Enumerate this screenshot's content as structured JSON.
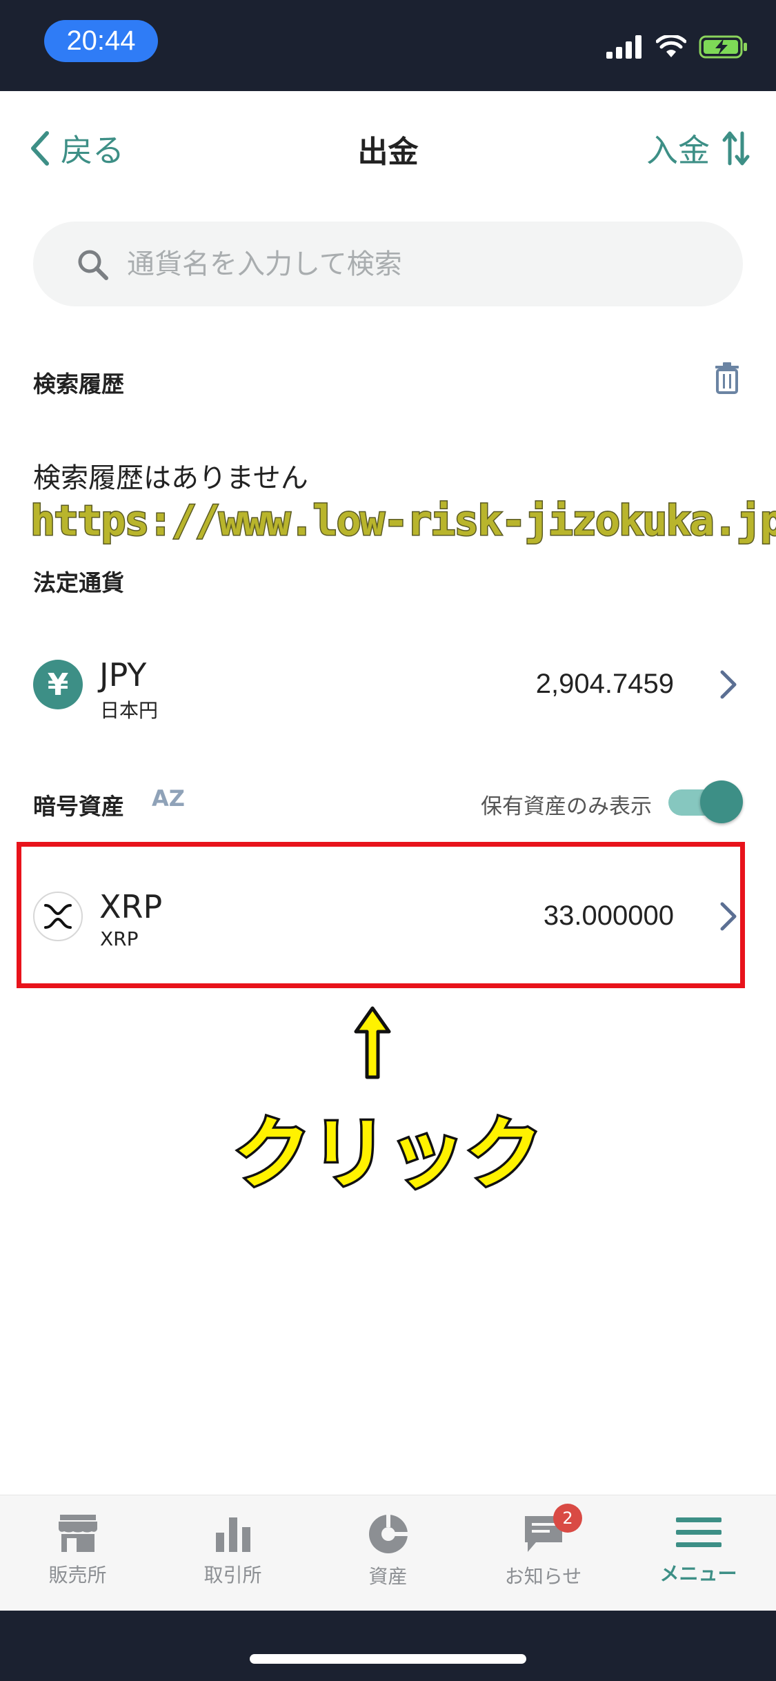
{
  "status_bar": {
    "time": "20:44"
  },
  "nav": {
    "back_label": "戻る",
    "title": "出金",
    "deposit_label": "入金"
  },
  "search": {
    "placeholder": "通貨名を入力して検索"
  },
  "history": {
    "title": "検索履歴",
    "empty_text": "検索履歴はありません"
  },
  "watermark": "https://www.low-risk-jizokuka.jp/",
  "fiat": {
    "title": "法定通貨",
    "items": [
      {
        "icon_glyph": "¥",
        "symbol": "JPY",
        "name": "日本円",
        "amount": "2,904.7459"
      }
    ]
  },
  "crypto": {
    "title": "暗号資産",
    "sort_label": "AZ",
    "own_only_label": "保有資産のみ表示",
    "own_only_enabled": true,
    "items": [
      {
        "symbol": "XRP",
        "name": "XRP",
        "amount": "33.000000"
      }
    ]
  },
  "annotation": {
    "text": "クリック"
  },
  "tabs": [
    {
      "label": "販売所",
      "icon": "store-icon"
    },
    {
      "label": "取引所",
      "icon": "bar-chart-icon"
    },
    {
      "label": "資産",
      "icon": "pie-chart-icon"
    },
    {
      "label": "お知らせ",
      "icon": "message-icon",
      "badge": "2"
    },
    {
      "label": "メニュー",
      "icon": "menu-icon",
      "active": true
    }
  ],
  "colors": {
    "accent": "#3d8f86",
    "status_bar": "#1b2130",
    "highlight": "#e8131b",
    "annotation": "#fff200"
  }
}
